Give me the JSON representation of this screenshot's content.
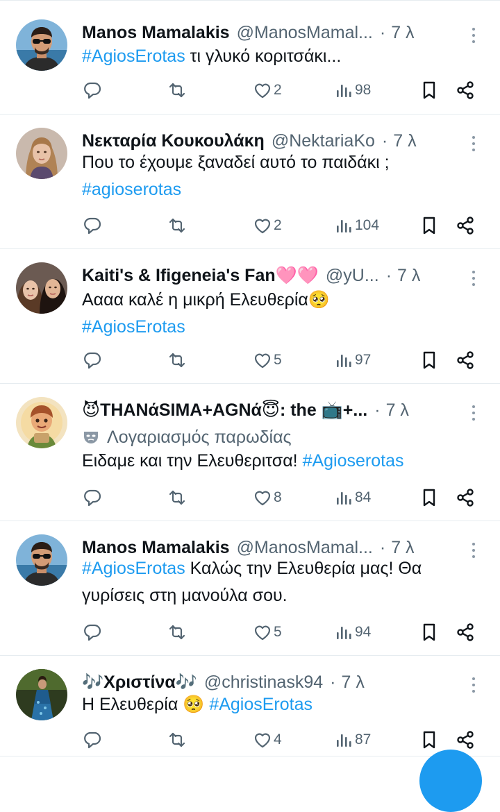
{
  "tweets": [
    {
      "name": "Manos Mamalakis",
      "handle": "@ManosMamal...",
      "time": "7 λ",
      "lines": [
        [
          {
            "t": "#AgiosErotas",
            "h": true
          },
          {
            "t": " τι γλυκό κοριτσάκι...",
            "h": false
          }
        ]
      ],
      "likes": "2",
      "views": "98",
      "avatar": "man-sunglasses"
    },
    {
      "name": "Νεκταρία Κουκουλάκη",
      "handle": "@NektariaKo",
      "time": "7 λ",
      "lines": [
        [
          {
            "t": "Που το έχουμε ξαναδεί αυτό το παιδάκι ;",
            "h": false
          }
        ],
        [
          {
            "t": "#agioserotas",
            "h": true
          }
        ]
      ],
      "likes": "2",
      "views": "104",
      "avatar": "woman-blonde"
    },
    {
      "name": "Kaiti's & Ifigeneia's Fan",
      "name_emoji": "🩷🩷",
      "handle": "@yU...",
      "time": "7 λ",
      "lines": [
        [
          {
            "t": "Αααα καλέ η μικρή Ελευθερία",
            "h": false
          },
          {
            "t": "🥺",
            "h": false,
            "e": true
          }
        ],
        [
          {
            "t": "#AgiosErotas",
            "h": true
          }
        ]
      ],
      "likes": "5",
      "views": "97",
      "avatar": "two-women"
    },
    {
      "name_emoji_pre": "😈",
      "name": "THANάSIMA+AGNά",
      "name_emoji": "😇",
      "name_tail": ": the 📺+...",
      "handle": "",
      "time": "7 λ",
      "parody": "Λογαριασμός παρωδίας",
      "lines": [
        [
          {
            "t": "Ειδαμε και την Ελευθεριτσα! ",
            "h": false
          },
          {
            "t": "#Agioserotas",
            "h": true
          }
        ]
      ],
      "likes": "8",
      "views": "84",
      "avatar": "cartoon-boy"
    },
    {
      "name": "Manos Mamalakis",
      "handle": "@ManosMamal...",
      "time": "7 λ",
      "lines": [
        [
          {
            "t": "#AgiosErotas",
            "h": true
          },
          {
            "t": " Καλώς την Ελευθερία μας! Θα",
            "h": false
          }
        ],
        [
          {
            "t": "γυρίσεις στη μανούλα σου.",
            "h": false
          }
        ]
      ],
      "likes": "5",
      "views": "94",
      "avatar": "man-sunglasses"
    },
    {
      "name_emoji_pre": "🎶",
      "name": "Χριστίνα",
      "name_emoji": "🎶",
      "handle": "@christinask94",
      "time": "7 λ",
      "lines": [
        [
          {
            "t": "Η Ελευθερία ",
            "h": false
          },
          {
            "t": "🥺",
            "h": false,
            "e": true
          },
          {
            "t": " ",
            "h": false
          },
          {
            "t": "#AgiosErotas",
            "h": true
          }
        ]
      ],
      "likes": "4",
      "views": "87",
      "avatar": "woman-dress"
    }
  ],
  "colors": {
    "accent": "#1d9bf0",
    "muted": "#536471",
    "text": "#0f1419",
    "divider": "#e6ecf0"
  }
}
